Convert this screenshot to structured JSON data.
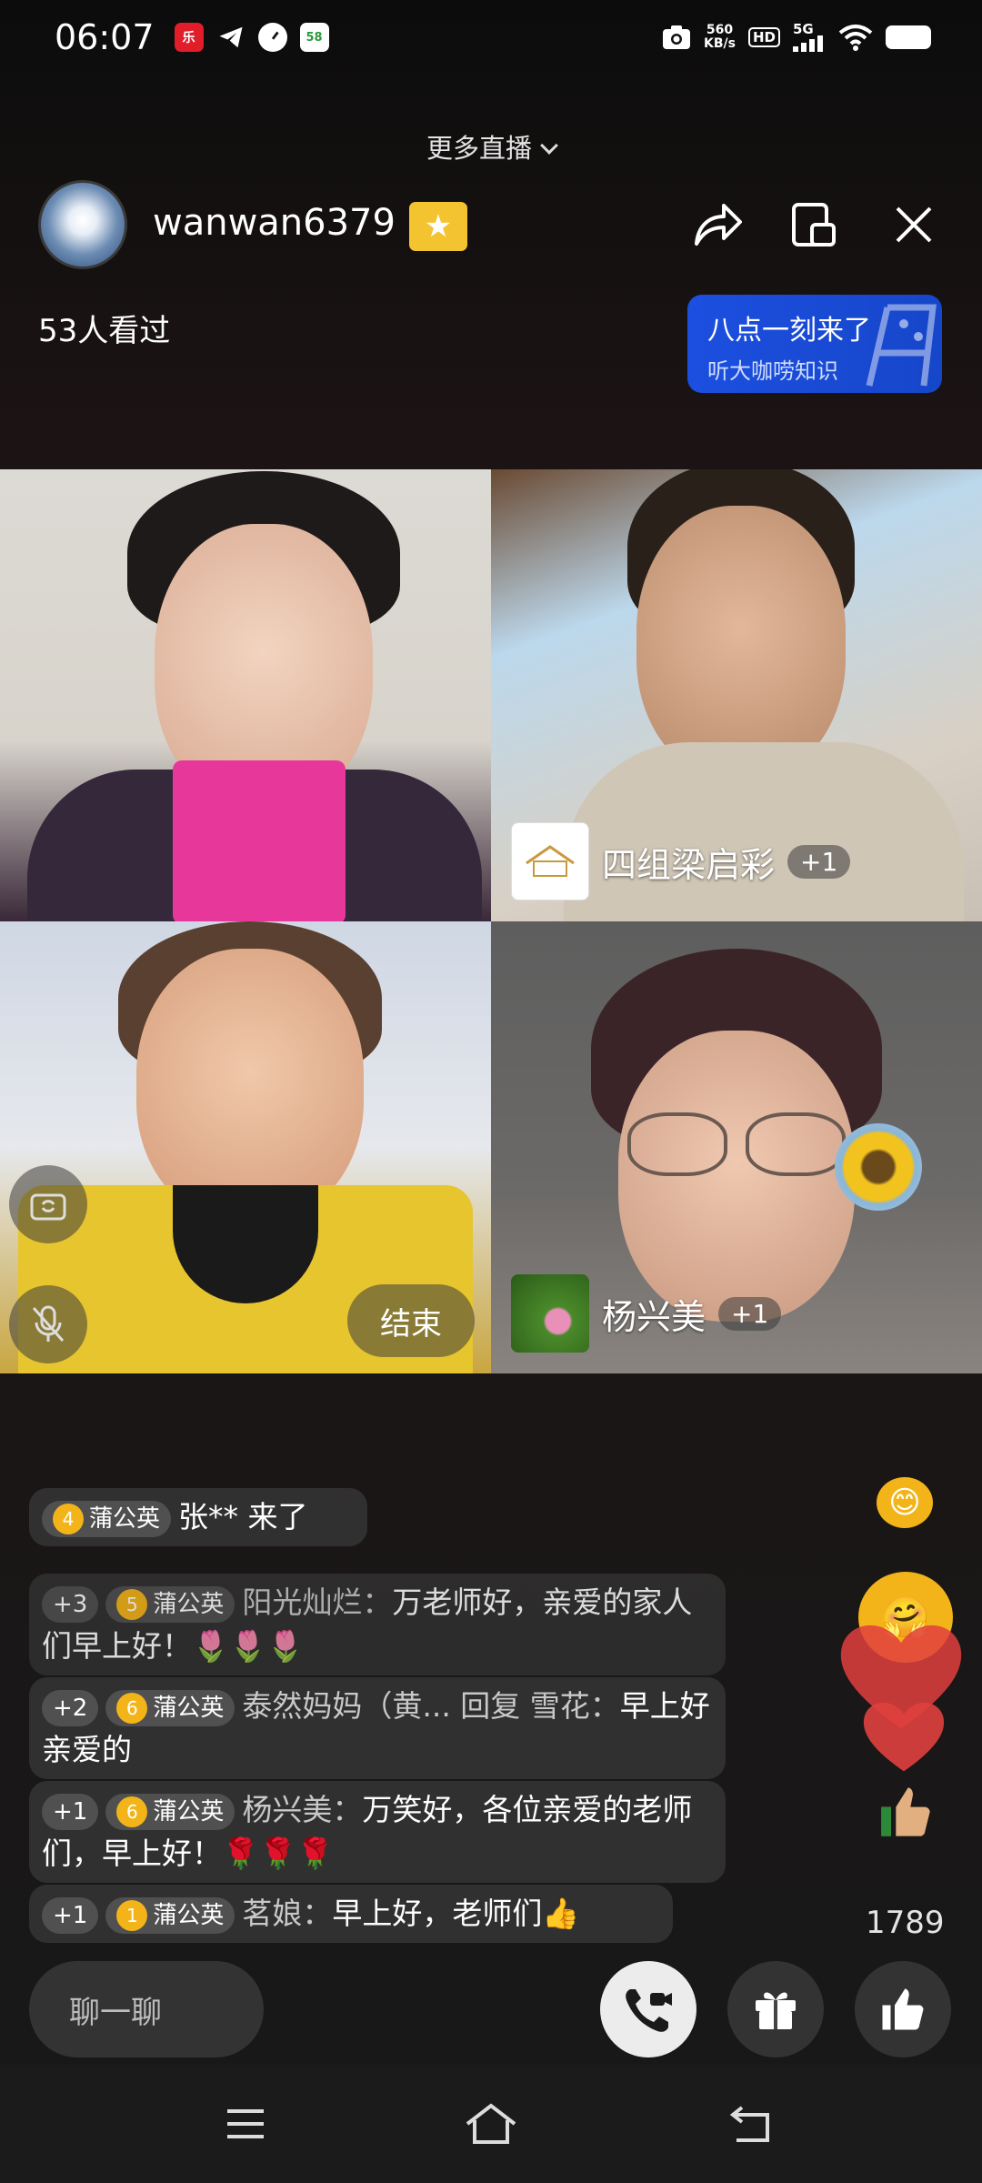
{
  "status_bar": {
    "time": "06:07",
    "net_speed_value": "560",
    "net_speed_unit": "KB/s",
    "hd": "HD",
    "signal": "5G"
  },
  "header": {
    "more_live_label": "更多直播",
    "host_name": "wanwan6379",
    "viewer_count": "53人看过",
    "promo_title": "八点一刻来了",
    "promo_subtitle": "听大咖唠知识"
  },
  "tiles": [
    {
      "name": "",
      "plus": ""
    },
    {
      "name": "四组梁启彩",
      "plus": "+1"
    },
    {
      "name": "",
      "plus": "",
      "end_label": "结束"
    },
    {
      "name": "杨兴美",
      "plus": "+1"
    }
  ],
  "chat": [
    {
      "level": "4",
      "badge": "蒲公英",
      "user": "",
      "text": "张** 来了"
    },
    {
      "plus": "+3",
      "level": "5",
      "badge": "蒲公英",
      "user": "阳光灿烂：",
      "text": "万老师好，亲爱的家人们早上好！🌷🌷🌷"
    },
    {
      "plus": "+2",
      "level": "6",
      "badge": "蒲公英",
      "user": "泰然妈妈（黄... 回复 雪花：",
      "text": "早上好亲爱的"
    },
    {
      "plus": "+1",
      "level": "6",
      "badge": "蒲公英",
      "user": "杨兴美：",
      "text": "万笑好，各位亲爱的老师们，早上好！🌹🌹🌹"
    },
    {
      "plus": "+1",
      "level": "1",
      "badge": "蒲公英",
      "user": "茗娘：",
      "text": "早上好，老师们👍"
    }
  ],
  "likes": "1789",
  "chat_input_placeholder": "聊一聊",
  "icons": [
    "share-icon",
    "pip-icon",
    "close-icon",
    "camera-flip-icon",
    "mic-off-icon",
    "video-call-icon",
    "gift-icon",
    "thumbs-up-icon",
    "menu-icon",
    "home-icon",
    "back-icon"
  ]
}
